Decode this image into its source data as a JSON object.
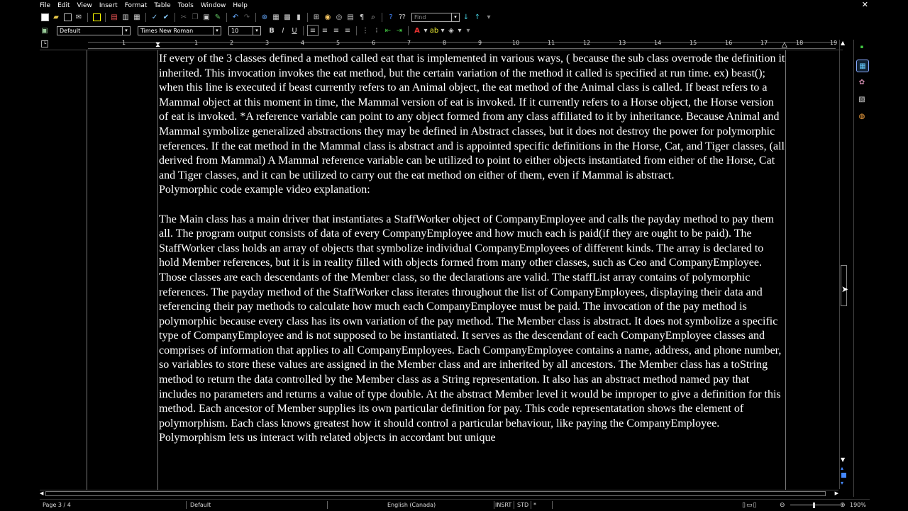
{
  "menu": [
    "File",
    "Edit",
    "View",
    "Insert",
    "Format",
    "Table",
    "Tools",
    "Window",
    "Help"
  ],
  "toolbar": {
    "find_placeholder": "Find",
    "paragraph_style": "Default",
    "font_name": "Times New Roman",
    "font_size": "10"
  },
  "ruler": {
    "numbers": [
      "1",
      "1",
      "2",
      "3",
      "4",
      "5",
      "6",
      "7",
      "8",
      "9",
      "10",
      "11",
      "12",
      "13",
      "14",
      "15",
      "16",
      "17",
      "18",
      "19"
    ]
  },
  "document": {
    "paragraphs": [
      "If every of the 3 classes defined a method called eat that is implemented in various ways, ( because the sub class overrode the definition it inherited. This invocation invokes the eat method, but the certain variation of the method it called is specified at run time. ex) beast();",
      "when this line is executed if beast currently refers to an Animal object, the eat method of the Animal class is called. If beast refers to a Mammal object at this moment in time, the Mammal version of eat is invoked. If it currently refers to a Horse object, the Horse version of eat is invoked. *A reference variable can point to any object formed from any class affiliated to it by inheritance. Because Animal and Mammal symbolize generalized abstractions they may be defined in Abstract classes, but it does not destroy the power for polymorphic references. If the eat method in the Mammal class is abstract and is appointed specific definitions in the Horse, Cat, and Tiger classes, (all derived from Mammal) A Mammal reference variable can be utilized to point to either objects instantiated from either of the Horse, Cat and Tiger classes, and it can be utilized to carry out the eat method on either of them, even if Mammal is abstract.",
      "Polymorphic code example video explanation:",
      "",
      "The Main class has a main driver that instantiates a StaffWorker object of CompanyEmployee and calls the payday method to pay them all. The program output consists of  data of every CompanyEmployee and how much each is paid(if they are ought to be paid). The StaffWorker class holds an array of objects that symbolize individual CompanyEmployees of different kinds. The array is declared to hold Member references, but it is in reality filled with objects formed from many other classes, such as Ceo and CompanyEmployee. Those classes are each descendants of the Member class, so the declarations are valid. The staffList array contains of polymorphic references. The payday method of the StaffWorker class iterates throughout the list of CompanyEmployees, displaying their data and referencing their pay methods to calculate how much each CompanyEmployee must be paid. The invocation of the pay method is polymorphic because every class has its own variation of the pay method. The Member class is abstract. It does not symbolize a specific type of CompanyEmployee and is not supposed to be instantiated. It serves as the descendant of each CompanyEmployee classes and comprises of information that applies to all CompanyEmployees. Each CompanyEmployee contains a name, address, and phone number, so variables to store these values are assigned in the Member class and are inherited by all ancestors. The Member class has a toString method to return the data controlled by the Member class as a String representation. It also has an abstract method named pay that includes no parameters and returns a value of type double. At the abstract Member level it would be improper to give a definition for this method. Each ancestor of Member supplies its own particular definition for pay. This code representatation shows the element of polymorphism. Each class knows greatest how it should control a particular behaviour, like paying the CompanyEmployee. Polymorphism lets us interact with related objects in accordant but unique"
    ]
  },
  "status": {
    "page": "Page 3 / 4",
    "style": "Default",
    "language": "English (Canada)",
    "insert_mode": "INSRT",
    "selection_mode": "STD",
    "modified": "*",
    "zoom": "190%"
  }
}
